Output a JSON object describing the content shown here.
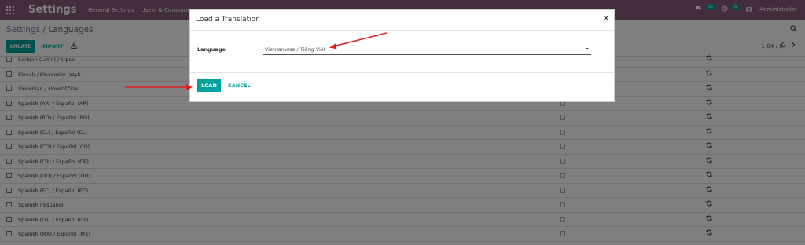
{
  "topbar": {
    "brand": "Settings",
    "menu": [
      "General Settings",
      "Users & Companies"
    ],
    "messages_count": "16",
    "activities_count": "6",
    "user": "Administrator"
  },
  "control_panel": {
    "breadcrumb_root": "Settings",
    "breadcrumb_sep": "/",
    "breadcrumb_current": "Languages",
    "create_label": "CREATE",
    "import_label": "IMPORT",
    "pager": "1-84 / 84"
  },
  "languages": [
    "Serbian (Latin) / srpski",
    "Slovak / Slovenský jazyk",
    "Slovenian / slovenščina",
    "Spanish (AR) / Español (AR)",
    "Spanish (BO) / Español (BO)",
    "Spanish (CL) / Español (CL)",
    "Spanish (CO) / Español (CO)",
    "Spanish (CR) / Español (CR)",
    "Spanish (DO) / Español (DO)",
    "Spanish (EC) / Español (EC)",
    "Spanish / Español",
    "Spanish (GT) / Español (GT)",
    "Spanish (MX) / Español (MX)"
  ],
  "modal": {
    "title": "Load a Translation",
    "close": "×",
    "field_label": "Language",
    "selected_language": "Vietnamese / Tiếng Việt",
    "load_label": "LOAD",
    "cancel_label": "CANCEL"
  },
  "colors": {
    "brand": "#875a7b",
    "primary": "#00a09d",
    "annotation": "#e02020"
  }
}
